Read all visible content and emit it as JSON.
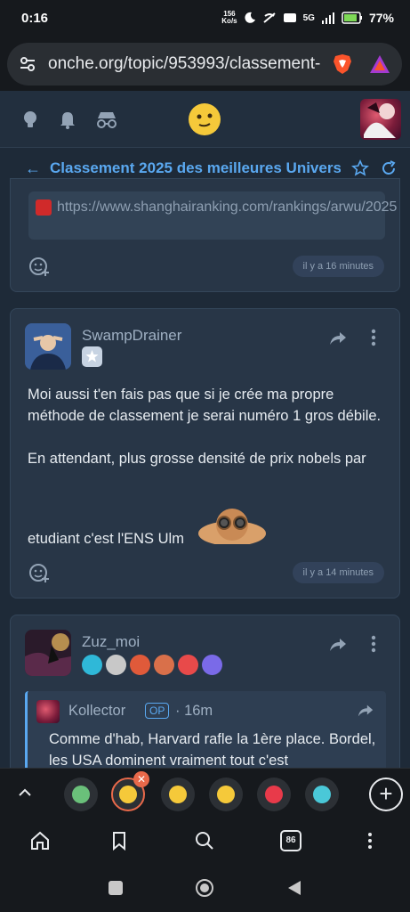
{
  "status": {
    "time": "0:16",
    "speed_value": "156",
    "speed_unit": "Ko/s",
    "network": "5G",
    "battery": "77%"
  },
  "browser": {
    "url": "onche.org/topic/953993/classement-"
  },
  "topic": {
    "title": "Classement 2025 des meilleures Universi"
  },
  "post1": {
    "link": "https://www.shanghairanking.com/rankings/arwu/2025",
    "time": "il y a 16 minutes"
  },
  "post2": {
    "author": "SwampDrainer",
    "body_line1": "Moi aussi t'en fais pas que si je crée ma propre méthode de classement je serai numéro 1 gros débile.",
    "body_line2": "En attendant, plus grosse densité de prix nobels par",
    "body_line3": "etudiant c'est l'ENS Ulm",
    "time": "il y a 14 minutes"
  },
  "post3": {
    "author": "Zuz_moi",
    "quote": {
      "author": "Kollector",
      "op_label": "OP",
      "time": "· 16m",
      "text": "Comme d'hab, Harvard rafle la 1ère place. Bordel, les USA dominent vraiment tout c'est"
    }
  },
  "nav": {
    "tab_count": "86"
  },
  "colors": {
    "accent": "#5aa8f0",
    "card": "#283647",
    "background": "#1e2a38"
  }
}
